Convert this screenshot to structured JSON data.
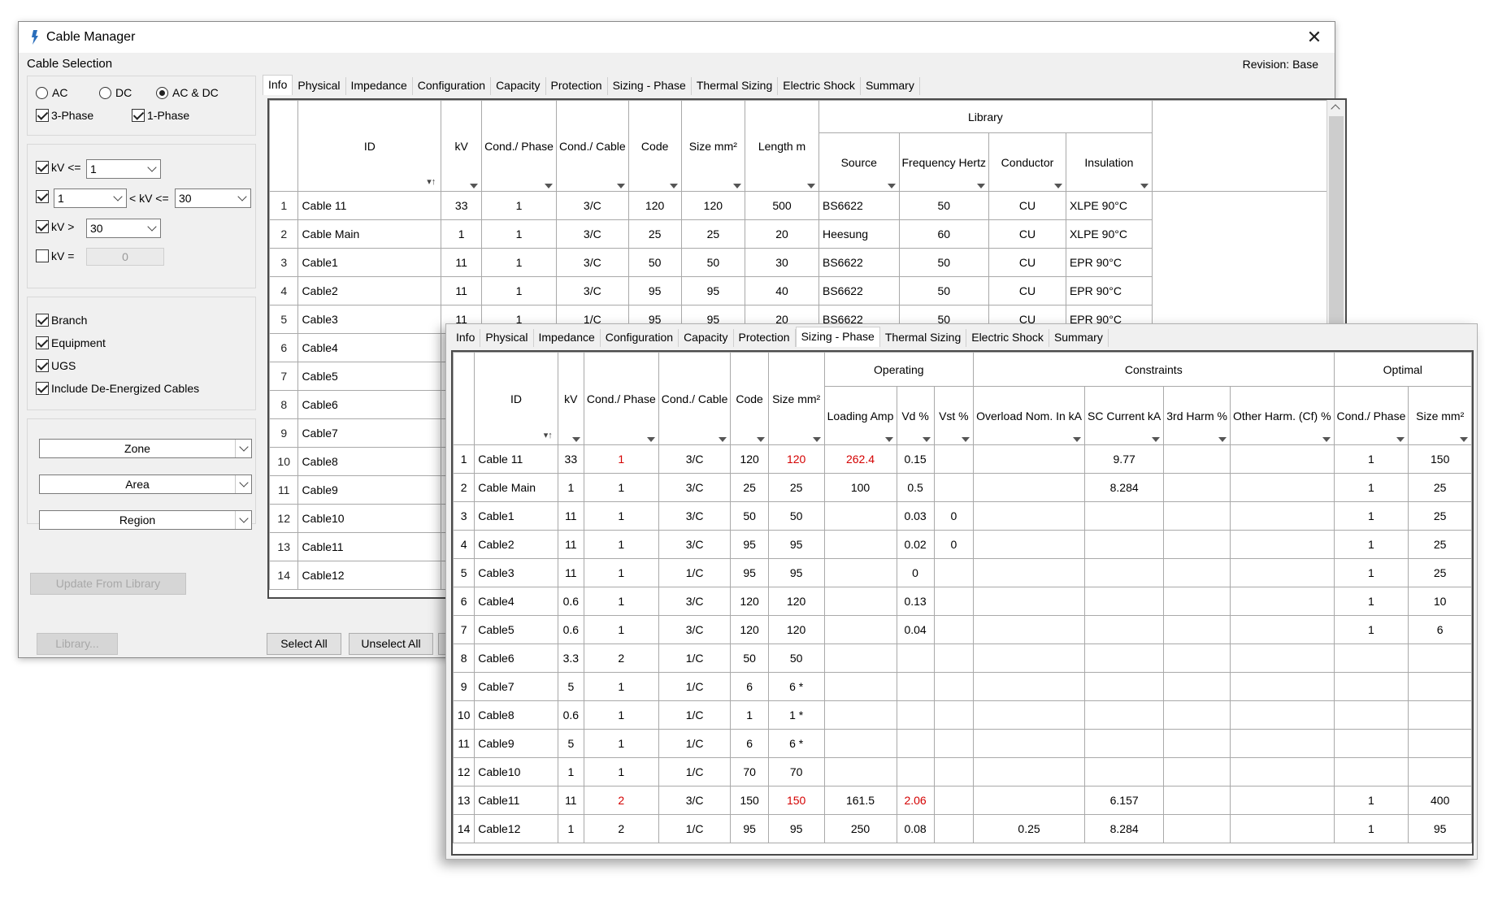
{
  "window": {
    "title": "Cable Manager",
    "section_label": "Cable Selection",
    "revision": "Revision: Base"
  },
  "filters": {
    "radios": [
      {
        "label": "AC",
        "selected": false
      },
      {
        "label": "DC",
        "selected": false
      },
      {
        "label": "AC & DC",
        "selected": true
      }
    ],
    "phase_checks": [
      {
        "label": "3-Phase",
        "checked": true
      },
      {
        "label": "1-Phase",
        "checked": true
      }
    ],
    "kv_le": {
      "label": "kV <=",
      "checked": true,
      "value": "1"
    },
    "kv_range": {
      "checked": true,
      "low": "1",
      "mid_label": "< kV <=",
      "high": "30"
    },
    "kv_gt": {
      "label": "kV >",
      "checked": true,
      "value": "30"
    },
    "kv_eq": {
      "label": "kV =",
      "checked": false,
      "value": "0"
    },
    "types": [
      {
        "label": "Branch",
        "checked": true
      },
      {
        "label": "Equipment",
        "checked": true
      },
      {
        "label": "UGS",
        "checked": true
      },
      {
        "label": "Include De-Energized Cables",
        "checked": true
      }
    ],
    "zone": "Zone",
    "area": "Area",
    "region": "Region"
  },
  "buttons": {
    "update_from_library": "Update From Library",
    "library": "Library...",
    "select_all": "Select All",
    "unselect_all": "Unselect All"
  },
  "tabs": [
    "Info",
    "Physical",
    "Impedance",
    "Configuration",
    "Capacity",
    "Protection",
    "Sizing - Phase",
    "Thermal Sizing",
    "Electric Shock",
    "Summary"
  ],
  "back_tab_active": "Info",
  "front_tab_active": "Sizing - Phase",
  "info_grid": {
    "headers": {
      "id": "ID",
      "kv": "kV",
      "cond_phase": "Cond./ Phase",
      "cond_cable": "Cond./ Cable",
      "code": "Code",
      "size": "Size mm²",
      "length": "Length m",
      "library": "Library",
      "source": "Source",
      "freq": "Frequency Hertz",
      "conductor": "Conductor",
      "insulation": "Insulation"
    },
    "rows": [
      [
        "1",
        "Cable 11",
        "33",
        "1",
        "3/C",
        "120",
        "120",
        "500",
        "BS6622",
        "50",
        "CU",
        "XLPE 90°C"
      ],
      [
        "2",
        "Cable Main",
        "1",
        "1",
        "3/C",
        "25",
        "25",
        "20",
        "Heesung",
        "60",
        "CU",
        "XLPE 90°C"
      ],
      [
        "3",
        "Cable1",
        "11",
        "1",
        "3/C",
        "50",
        "50",
        "30",
        "BS6622",
        "50",
        "CU",
        "EPR 90°C"
      ],
      [
        "4",
        "Cable2",
        "11",
        "1",
        "3/C",
        "95",
        "95",
        "40",
        "BS6622",
        "50",
        "CU",
        "EPR 90°C"
      ],
      [
        "5",
        "Cable3",
        "11",
        "1",
        "1/C",
        "95",
        "95",
        "20",
        "BS6622",
        "50",
        "CU",
        "EPR 90°C"
      ],
      [
        "6",
        "Cable4"
      ],
      [
        "7",
        "Cable5"
      ],
      [
        "8",
        "Cable6"
      ],
      [
        "9",
        "Cable7"
      ],
      [
        "10",
        "Cable8"
      ],
      [
        "11",
        "Cable9"
      ],
      [
        "12",
        "Cable10"
      ],
      [
        "13",
        "Cable11"
      ],
      [
        "14",
        "Cable12"
      ]
    ]
  },
  "sizing_grid": {
    "groups": {
      "operating": "Operating",
      "constraints": "Constraints",
      "optimal": "Optimal"
    },
    "headers": {
      "id": "ID",
      "kv": "kV",
      "cond_phase": "Cond./ Phase",
      "cond_cable": "Cond./ Cable",
      "code": "Code",
      "size": "Size mm²",
      "loading": "Loading Amp",
      "vd": "Vd %",
      "vst": "Vst %",
      "overload": "Overload Nom. In kA",
      "sc": "SC Current kA",
      "harm3": "3rd Harm %",
      "other_harm": "Other Harm. (Cf) %",
      "opt_cond": "Cond./ Phase",
      "opt_size": "Size mm²"
    },
    "rows": [
      [
        "1",
        "Cable 11",
        "33",
        "1",
        "3/C",
        "120",
        "120",
        "262.4",
        "0.15",
        "",
        "",
        "9.77",
        "",
        "",
        "1",
        "150"
      ],
      [
        "2",
        "Cable Main",
        "1",
        "1",
        "3/C",
        "25",
        "25",
        "100",
        "0.5",
        "",
        "",
        "8.284",
        "",
        "",
        "1",
        "25"
      ],
      [
        "3",
        "Cable1",
        "11",
        "1",
        "3/C",
        "50",
        "50",
        "",
        "0.03",
        "0",
        "",
        "",
        "",
        "",
        "1",
        "25"
      ],
      [
        "4",
        "Cable2",
        "11",
        "1",
        "3/C",
        "95",
        "95",
        "",
        "0.02",
        "0",
        "",
        "",
        "",
        "",
        "1",
        "25"
      ],
      [
        "5",
        "Cable3",
        "11",
        "1",
        "1/C",
        "95",
        "95",
        "",
        "0",
        "",
        "",
        "",
        "",
        "",
        "1",
        "25"
      ],
      [
        "6",
        "Cable4",
        "0.6",
        "1",
        "3/C",
        "120",
        "120",
        "",
        "0.13",
        "",
        "",
        "",
        "",
        "",
        "1",
        "10"
      ],
      [
        "7",
        "Cable5",
        "0.6",
        "1",
        "3/C",
        "120",
        "120",
        "",
        "0.04",
        "",
        "",
        "",
        "",
        "",
        "1",
        "6"
      ],
      [
        "8",
        "Cable6",
        "3.3",
        "2",
        "1/C",
        "50",
        "50",
        "",
        "",
        "",
        "",
        "",
        "",
        "",
        "",
        ""
      ],
      [
        "9",
        "Cable7",
        "5",
        "1",
        "1/C",
        "6",
        "6 *",
        "",
        "",
        "",
        "",
        "",
        "",
        "",
        "",
        ""
      ],
      [
        "10",
        "Cable8",
        "0.6",
        "1",
        "1/C",
        "1",
        "1 *",
        "",
        "",
        "",
        "",
        "",
        "",
        "",
        "",
        ""
      ],
      [
        "11",
        "Cable9",
        "5",
        "1",
        "1/C",
        "6",
        "6 *",
        "",
        "",
        "",
        "",
        "",
        "",
        "",
        "",
        ""
      ],
      [
        "12",
        "Cable10",
        "1",
        "1",
        "1/C",
        "70",
        "70",
        "",
        "",
        "",
        "",
        "",
        "",
        "",
        "",
        ""
      ],
      [
        "13",
        "Cable11",
        "11",
        "2",
        "3/C",
        "150",
        "150",
        "161.5",
        "2.06",
        "",
        "",
        "6.157",
        "",
        "",
        "1",
        "400"
      ],
      [
        "14",
        "Cable12",
        "1",
        "2",
        "1/C",
        "95",
        "95",
        "250",
        "0.08",
        "",
        "0.25",
        "8.284",
        "",
        "",
        "1",
        "95"
      ]
    ],
    "red_cells": [
      [
        0,
        3
      ],
      [
        0,
        6
      ],
      [
        0,
        7
      ],
      [
        12,
        3
      ],
      [
        12,
        6
      ],
      [
        12,
        8
      ]
    ]
  },
  "colors": {
    "highlight_red": "#d40000",
    "grid_gray": "#a6a6a6"
  }
}
